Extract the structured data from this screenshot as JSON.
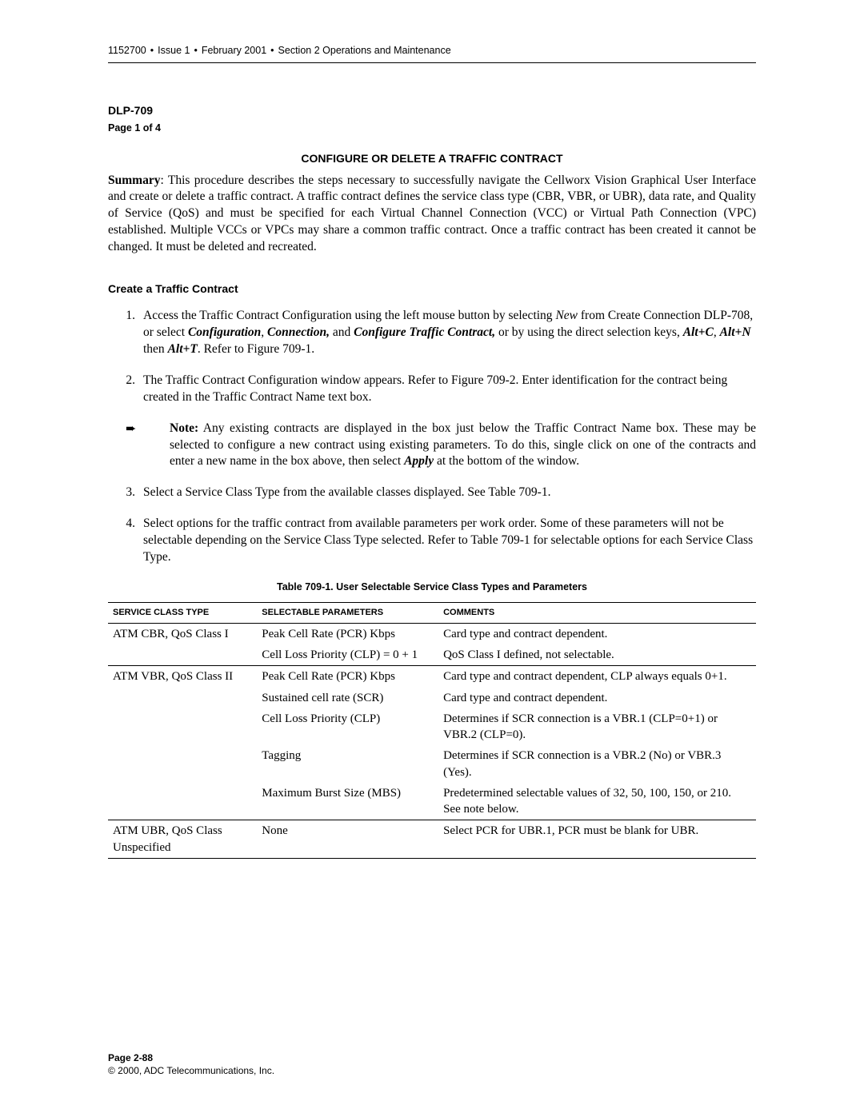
{
  "header": {
    "doc_num": "1152700",
    "issue": "Issue 1",
    "date": "February 2001",
    "section": "Section 2 Operations and Maintenance"
  },
  "doc_id": "DLP-709",
  "page_of": "Page 1 of 4",
  "title": "CONFIGURE OR DELETE A TRAFFIC CONTRACT",
  "summary_label": "Summary",
  "summary_text": ": This procedure describes the steps necessary to successfully navigate the Cellworx Vision Graphical User Interface and create or delete a traffic contract. A traffic contract defines the service class type (CBR, VBR, or UBR), data rate, and Quality of Service (QoS) and must be specified for each Virtual Channel Connection (VCC) or Virtual Path Connection (VPC) established. Multiple VCCs or VPCs may share a common traffic contract.  Once a traffic contract has been created it cannot be changed. It must be deleted and recreated.",
  "section_head": "Create a Traffic Contract",
  "steps": {
    "s1": {
      "num": "1.",
      "t1": "Access the Traffic Contract Configuration using the left mouse button by selecting ",
      "i1": "New",
      "t2": " from Create Connection DLP-708, or select ",
      "b1": "Configuration",
      "t3": ", ",
      "b2": "Connection,",
      "t4": " and ",
      "b3": "Configure Traffic Contract,",
      "t5": " or by using the direct selection keys, ",
      "b4": "Alt+C",
      "t6": ", ",
      "b5": "Alt+N",
      "t7": " then ",
      "b6": "Alt+T",
      "t8": ". Refer to Figure 709-1."
    },
    "s2": {
      "num": "2.",
      "t1": "The Traffic Contract Configuration window appears. Refer to ",
      "link": "Figure 709-2",
      "t2": ". Enter identification for the contract being created in the Traffic Contract Name text box."
    },
    "note": {
      "label": "Note:",
      "t1": " Any existing contracts are displayed in the box just below the Traffic Contract Name box. These may be selected to configure a new contract using existing parameters. To do this, single click on one of the contracts and enter a new name in the box above, then select ",
      "b1": "Apply",
      "t2": " at the bottom of the window."
    },
    "s3": {
      "num": "3.",
      "t1": "Select a Service Class Type from the available classes displayed. See ",
      "link": "Table 709-1",
      "t2": "."
    },
    "s4": {
      "num": "4.",
      "t1": "Select options for the traffic contract from available parameters per work order. Some of these parameters will not be selectable depending on the Service Class Type selected. Refer to ",
      "link": "Table 709-1",
      "t2": " for selectable options for each Service Class Type."
    }
  },
  "table": {
    "caption": "Table 709-1.  User Selectable Service Class Types and Parameters",
    "headers": {
      "h1": "SERVICE CLASS TYPE",
      "h2": "SELECTABLE PARAMETERS",
      "h3": "COMMENTS"
    },
    "rows": [
      {
        "a": "ATM CBR, QoS Class I",
        "b": "Peak Cell Rate (PCR) Kbps",
        "c": "Card type and contract dependent.",
        "group_start": true
      },
      {
        "a": "",
        "b": "Cell Loss Priority (CLP) = 0 + 1",
        "c": "QoS Class I defined, not selectable."
      },
      {
        "a": "ATM VBR, QoS Class II",
        "b": "Peak Cell Rate (PCR) Kbps",
        "c": "Card type and contract dependent, CLP always equals 0+1.",
        "group_start": true
      },
      {
        "a": "",
        "b": "Sustained cell rate (SCR)",
        "c": "Card type and contract dependent."
      },
      {
        "a": "",
        "b": "Cell Loss Priority (CLP)",
        "c": "Determines if SCR connection is a VBR.1 (CLP=0+1) or VBR.2 (CLP=0)."
      },
      {
        "a": "",
        "b": "Tagging",
        "c": "Determines if SCR connection is a VBR.2 (No) or VBR.3 (Yes)."
      },
      {
        "a": "",
        "b": "Maximum Burst Size (MBS)",
        "c": "Predetermined selectable values of 32, 50, 100, 150, or 210. See note below."
      },
      {
        "a": "ATM UBR, QoS Class Unspecified",
        "b": "None",
        "c": "Select PCR for UBR.1,  PCR must be blank for UBR.",
        "group_start": true,
        "last": true
      }
    ]
  },
  "footer": {
    "page": "Page 2-88",
    "copyright": "© 2000, ADC Telecommunications, Inc."
  }
}
